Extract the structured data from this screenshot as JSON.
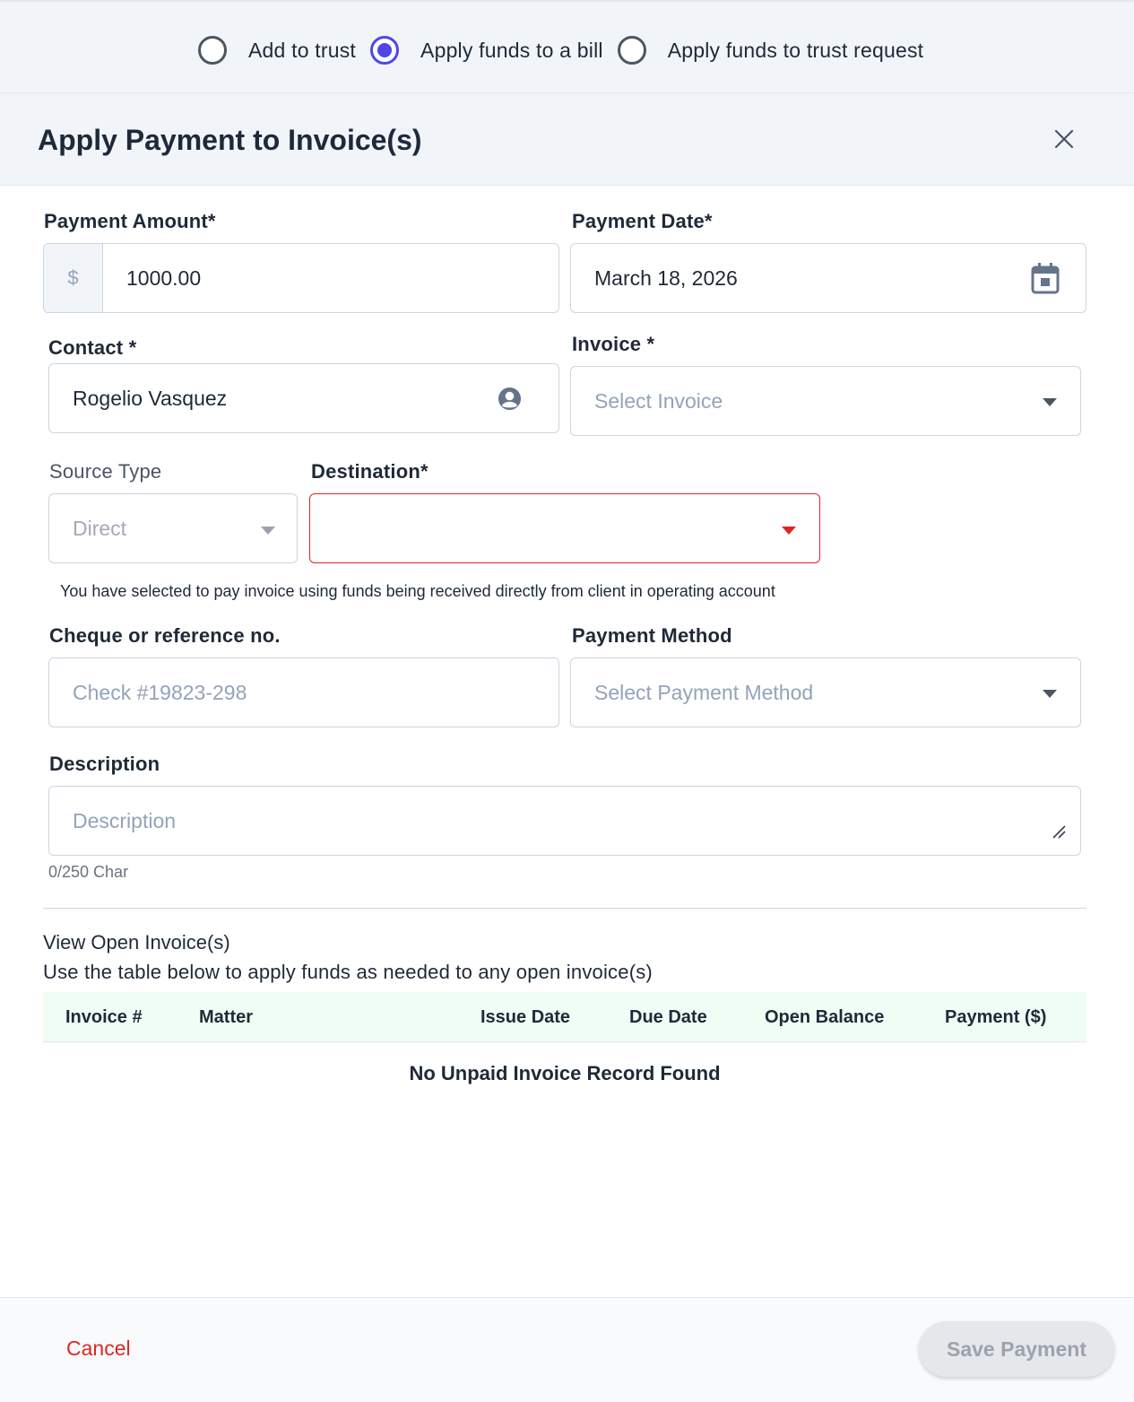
{
  "payment_type": {
    "options": [
      {
        "label": "Add to trust",
        "checked": false
      },
      {
        "label": "Apply funds to a bill",
        "checked": true
      },
      {
        "label": "Apply funds to trust request",
        "checked": false
      }
    ]
  },
  "dialog": {
    "title": "Apply Payment to Invoice(s)",
    "close_icon": "close-icon"
  },
  "form": {
    "payment_amount": {
      "label": "Payment Amount*",
      "prefix": "$",
      "value": "1000.00"
    },
    "payment_date": {
      "label": "Payment Date*",
      "value": "March 18, 2026",
      "icon": "calendar-icon"
    },
    "contact": {
      "label": "Contact *",
      "value": "Rogelio Vasquez",
      "icon": "user-circle-icon"
    },
    "invoice": {
      "label": "Invoice *",
      "placeholder": "Select Invoice"
    },
    "source_type": {
      "label": "Source Type",
      "value": "Direct"
    },
    "destination": {
      "label": "Destination*",
      "value": "",
      "error_color": "#dc2626"
    },
    "hint": "You have selected to pay invoice using funds being received directly from client in operating account",
    "reference": {
      "label": "Cheque or reference no.",
      "placeholder": "Check #19823-298"
    },
    "payment_method": {
      "label": "Payment Method",
      "placeholder": "Select Payment Method"
    },
    "description": {
      "label": "Description",
      "placeholder": "Description",
      "char_count": "0/250 Char"
    }
  },
  "open_invoices": {
    "title": "View Open Invoice(s)",
    "subtitle": "Use the table below to apply funds as needed to any open invoice(s)",
    "columns": [
      "Invoice #",
      "Matter",
      "Issue Date",
      "Due Date",
      "Open Balance",
      "Payment ($)"
    ],
    "empty_message": "No Unpaid Invoice Record Found"
  },
  "footer": {
    "cancel_label": "Cancel",
    "save_label": "Save Payment"
  },
  "colors": {
    "accent": "#4f46e5",
    "danger": "#dc2626",
    "table_header_bg": "#f0fdf4"
  }
}
